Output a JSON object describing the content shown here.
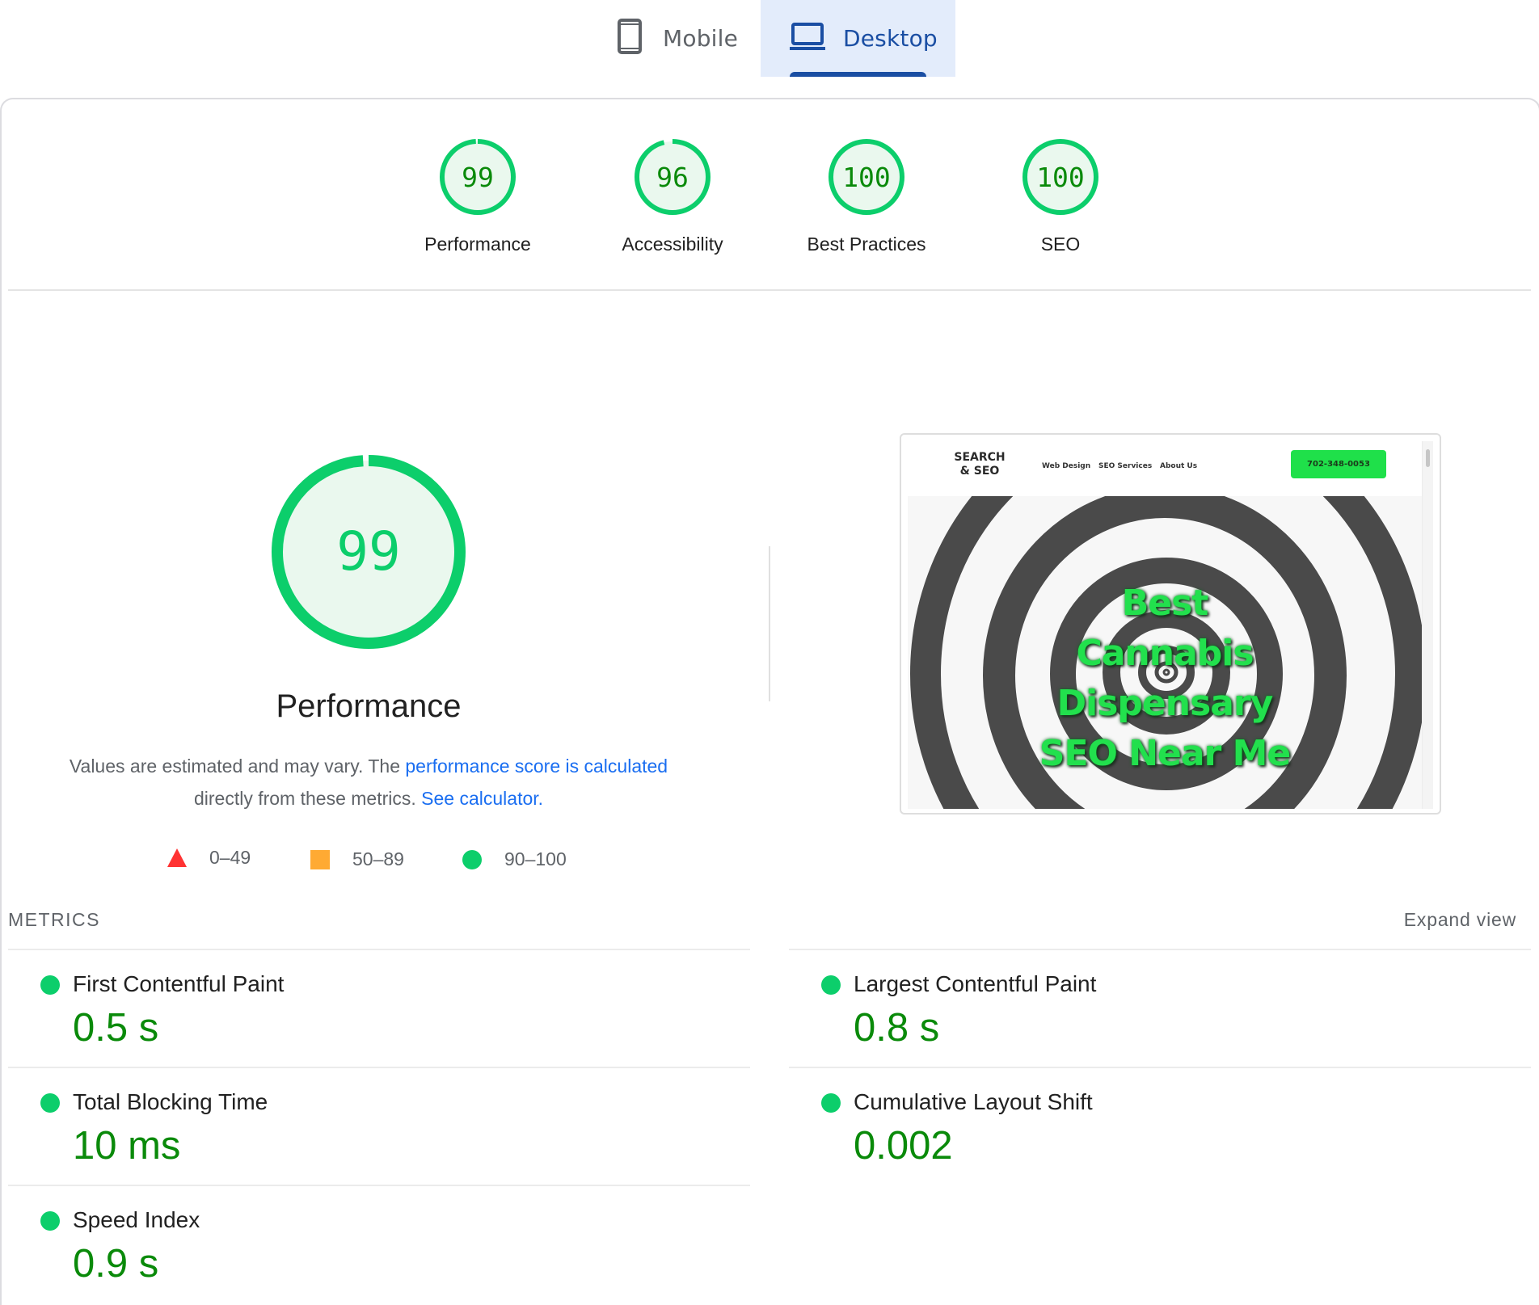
{
  "tabs": [
    {
      "label": "Mobile",
      "icon": "phone-icon",
      "selected": false
    },
    {
      "label": "Desktop",
      "icon": "laptop-icon",
      "selected": true
    }
  ],
  "scores": [
    {
      "label": "Performance",
      "value": 99
    },
    {
      "label": "Accessibility",
      "value": 96
    },
    {
      "label": "Best Practices",
      "value": 100
    },
    {
      "label": "SEO",
      "value": 100
    }
  ],
  "performance": {
    "score": 99,
    "title": "Performance",
    "description_prefix": "Values are estimated and may vary. The ",
    "description_link1": "performance score is calculated",
    "description_middle": " directly from these metrics. ",
    "description_link2": "See calculator."
  },
  "legend": [
    {
      "range": "0–49",
      "shape": "triangle",
      "color": "#ff3333"
    },
    {
      "range": "50–89",
      "shape": "square",
      "color": "#ffaa33"
    },
    {
      "range": "90–100",
      "shape": "circle",
      "color": "#0cce6b"
    }
  ],
  "screenshot": {
    "logo": "SEARCH & SEO",
    "logo_line1": "SEARCH",
    "logo_line2": "& SEO",
    "nav": [
      "Web Design",
      "SEO Services",
      "About Us"
    ],
    "phone": "702-348-0053",
    "headline": [
      "Best",
      "Cannabis",
      "Dispensary",
      "SEO Near Me"
    ]
  },
  "metrics": {
    "header": "METRICS",
    "expand_label": "Expand view",
    "items": [
      {
        "label": "First Contentful Paint",
        "value": "0.5 s",
        "status": "pass"
      },
      {
        "label": "Largest Contentful Paint",
        "value": "0.8 s",
        "status": "pass"
      },
      {
        "label": "Total Blocking Time",
        "value": "10 ms",
        "status": "pass"
      },
      {
        "label": "Cumulative Layout Shift",
        "value": "0.002",
        "status": "pass"
      },
      {
        "label": "Speed Index",
        "value": "0.9 s",
        "status": "pass"
      }
    ]
  },
  "colors": {
    "pass": "#0cce6b",
    "pass_text": "#0a8a0a",
    "gauge_fill": "#eaf8ee",
    "average": "#ffaa33",
    "fail": "#ff3333",
    "link": "#1a6ef1",
    "tab_active": "#1a4ea3",
    "tab_active_bg": "#e3ecfb"
  }
}
